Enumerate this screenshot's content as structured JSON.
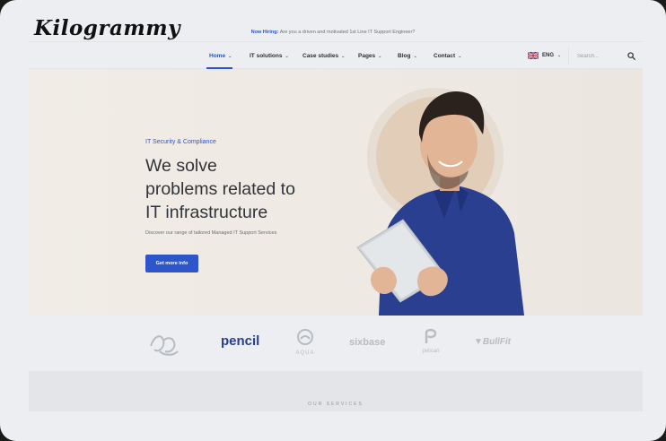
{
  "watermark": "Kilogrammy",
  "topbar": {
    "hiring_label": "Now Hiring:",
    "hiring_text": "Are you a driven and motivated 1st Line IT Support Engineer?"
  },
  "nav": {
    "items": [
      {
        "label": "Home",
        "active": true
      },
      {
        "label": "IT solutions"
      },
      {
        "label": "Case studies"
      },
      {
        "label": "Pages"
      },
      {
        "label": "Blog"
      },
      {
        "label": "Contact"
      }
    ],
    "language": "ENG",
    "search_placeholder": "Search..."
  },
  "hero": {
    "eyebrow": "IT Security & Compliance",
    "headline_lines": [
      "We solve",
      "problems related to",
      "IT infrastructure"
    ],
    "subtext": "Discover our range of tailored Managed IT Support Services",
    "cta_label": "Get more info"
  },
  "brands": {
    "items": [
      {
        "name": "Nature",
        "icon": "script-logo"
      },
      {
        "name": "pencil",
        "icon": "pencil-wordmark"
      },
      {
        "name": "AQUA",
        "icon": "aqua-logo"
      },
      {
        "name": "sixbase",
        "icon": "sixbase-wordmark"
      },
      {
        "name": "pelican",
        "icon": "pelican-logo"
      },
      {
        "name": "BullFit",
        "icon": "bullfit-logo"
      }
    ]
  },
  "services": {
    "label": "OUR SERVICES"
  },
  "colors": {
    "accent": "#2c56c9",
    "hero_bg": "#efe9e3",
    "text_dark": "#30343b",
    "shirt": "#2a3f8f"
  }
}
